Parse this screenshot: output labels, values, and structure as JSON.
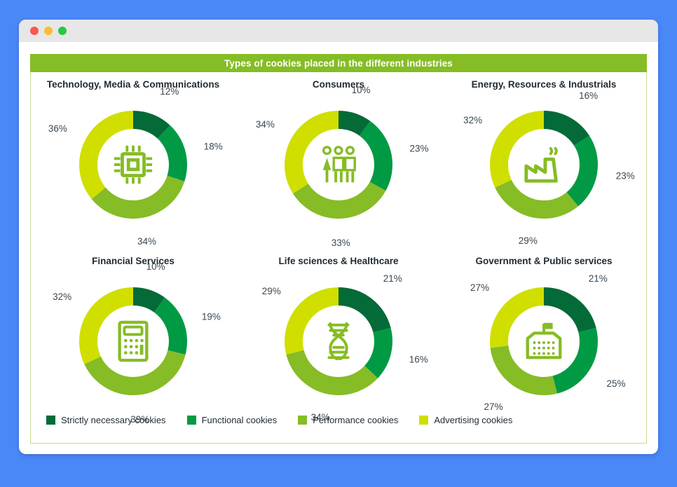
{
  "window": {
    "traffic_lights": [
      "close",
      "minimize",
      "maximize"
    ]
  },
  "banner": {
    "title": "Types of cookies placed in the different industries"
  },
  "colors": {
    "strictly_necessary": "#046a38",
    "functional": "#009a44",
    "performance": "#86bc25",
    "advertising": "#d0df00",
    "banner_bg": "#86bc25",
    "panel_border": "#c3de8e",
    "page_bg": "#4a87f7",
    "label_text": "#3a4750"
  },
  "legend": {
    "items": [
      {
        "label": "Strictly necessary cookies",
        "color": "#046a38",
        "key": "strictly_necessary"
      },
      {
        "label": "Functional cookies",
        "color": "#009a44",
        "key": "functional"
      },
      {
        "label": "Performance cookies",
        "color": "#86bc25",
        "key": "performance"
      },
      {
        "label": "Advertising cookies",
        "color": "#d0df00",
        "key": "advertising"
      }
    ]
  },
  "chart_data": [
    {
      "type": "pie",
      "title": "Technology, Media & Communications",
      "icon": "microchip-icon",
      "categories": [
        "Strictly necessary cookies",
        "Functional cookies",
        "Performance cookies",
        "Advertising cookies"
      ],
      "values": [
        12,
        18,
        34,
        36
      ],
      "labels": [
        "12%",
        "18%",
        "34%",
        "36%"
      ],
      "colors": [
        "#046a38",
        "#009a44",
        "#86bc25",
        "#d0df00"
      ]
    },
    {
      "type": "pie",
      "title": "Consumers",
      "icon": "people-group-icon",
      "categories": [
        "Strictly necessary cookies",
        "Functional cookies",
        "Performance cookies",
        "Advertising cookies"
      ],
      "values": [
        10,
        23,
        33,
        34
      ],
      "labels": [
        "10%",
        "23%",
        "33%",
        "34%"
      ],
      "colors": [
        "#046a38",
        "#009a44",
        "#86bc25",
        "#d0df00"
      ]
    },
    {
      "type": "pie",
      "title": "Energy, Resources & Industrials",
      "icon": "factory-icon",
      "categories": [
        "Strictly necessary cookies",
        "Functional cookies",
        "Performance cookies",
        "Advertising cookies"
      ],
      "values": [
        16,
        23,
        29,
        32
      ],
      "labels": [
        "16%",
        "23%",
        "29%",
        "32%"
      ],
      "colors": [
        "#046a38",
        "#009a44",
        "#86bc25",
        "#d0df00"
      ]
    },
    {
      "type": "pie",
      "title": "Financial Services",
      "icon": "calculator-icon",
      "categories": [
        "Strictly necessary cookies",
        "Functional cookies",
        "Performance cookies",
        "Advertising cookies"
      ],
      "values": [
        10,
        19,
        39,
        32
      ],
      "labels": [
        "10%",
        "19%",
        "39%",
        "32%"
      ],
      "colors": [
        "#046a38",
        "#009a44",
        "#86bc25",
        "#d0df00"
      ]
    },
    {
      "type": "pie",
      "title": "Life sciences & Healthcare",
      "icon": "dna-icon",
      "categories": [
        "Strictly necessary cookies",
        "Functional cookies",
        "Performance cookies",
        "Advertising cookies"
      ],
      "values": [
        21,
        16,
        34,
        29
      ],
      "labels": [
        "21%",
        "16%",
        "34%",
        "29%"
      ],
      "colors": [
        "#046a38",
        "#009a44",
        "#86bc25",
        "#d0df00"
      ]
    },
    {
      "type": "pie",
      "title": "Government & Public services",
      "icon": "government-building-icon",
      "categories": [
        "Strictly necessary cookies",
        "Functional cookies",
        "Performance cookies",
        "Advertising cookies"
      ],
      "values": [
        21,
        25,
        27,
        27
      ],
      "labels": [
        "21%",
        "25%",
        "27%",
        "27%"
      ],
      "colors": [
        "#046a38",
        "#009a44",
        "#86bc25",
        "#d0df00"
      ]
    }
  ]
}
